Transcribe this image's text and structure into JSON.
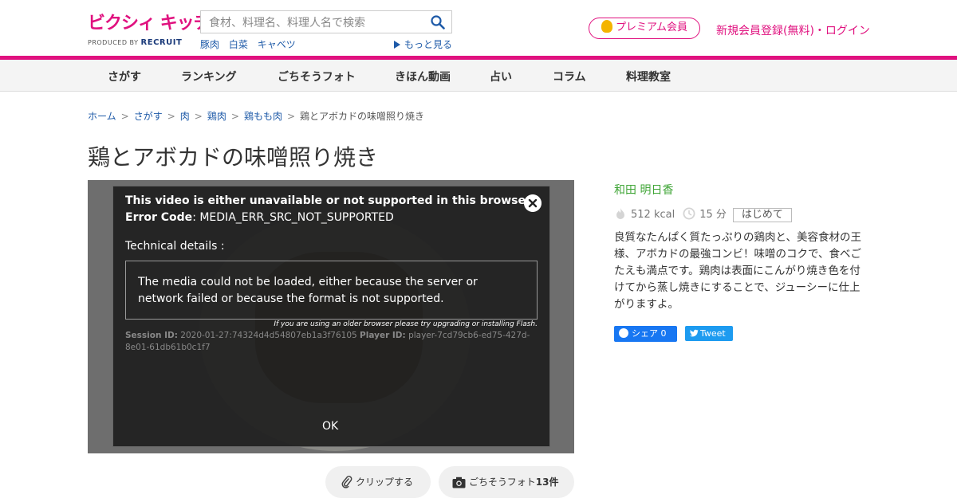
{
  "header": {
    "logo_text": "ビクシィ キッチン",
    "logo_sub": "PRODUCED BY",
    "logo_brand": "RECRUIT",
    "search_placeholder": "食材、料理名、料理人名で検索",
    "tags": [
      "豚肉",
      "白菜",
      "キャベツ"
    ],
    "more_label": "もっと見る",
    "premium_label": "プレミアム会員",
    "signup_label": "新規会員登録(無料)・ログイン"
  },
  "nav": [
    "さがす",
    "ランキング",
    "ごちそうフォト",
    "きほん動画",
    "占い",
    "コラム",
    "料理教室"
  ],
  "breadcrumb": {
    "items": [
      "ホーム",
      "さがす",
      "肉",
      "鶏肉",
      "鶏もも肉"
    ],
    "current": "鶏とアボカドの味噌照り焼き",
    "separator": ">"
  },
  "recipe": {
    "title": "鶏とアボカドの味噌照り焼き",
    "author": "和田 明日香",
    "calories": "512 kcal",
    "time": "15 分",
    "level": "はじめて",
    "description": "良質なたんぱく質たっぷりの鶏肉と、美容食材の王様、アボカドの最強コンビ！味噌のコクで、食べごたえも満点です。鶏肉は表面にこんがり焼き色を付けてから蒸し焼きにすることで、ジューシーに仕上がりますよ。"
  },
  "video_error": {
    "heading": "This video is either unavailable or not supported in this browser",
    "error_code_label": "Error Code",
    "error_code": ": MEDIA_ERR_SRC_NOT_SUPPORTED",
    "tech_label": "Technical details :",
    "message": "The media could not be loaded, either because the server or network failed or because the format is not supported.",
    "flash_note": "If you are using an older browser please try upgrading or installing Flash.",
    "session_label": "Session ID:",
    "session_id": "2020-01-27:74324d4d54807eb1a3f76105",
    "player_label": "Player ID:",
    "player_id": "player-7cd79cb6-ed75-427d-8e01-61db61b0c1f7",
    "ok_label": "OK"
  },
  "actions": {
    "clip_label": "クリップする",
    "photo_label": "ごちそうフォト",
    "photo_count": "13件"
  },
  "social": {
    "share_label": "シェア",
    "share_count": "0",
    "tweet_label": "Tweet"
  },
  "colors": {
    "brand_pink": "#e0117f",
    "link_blue": "#1e5aa8",
    "author_green": "#3fa536",
    "facebook_blue": "#1877f2",
    "twitter_blue": "#1d9bf0"
  }
}
